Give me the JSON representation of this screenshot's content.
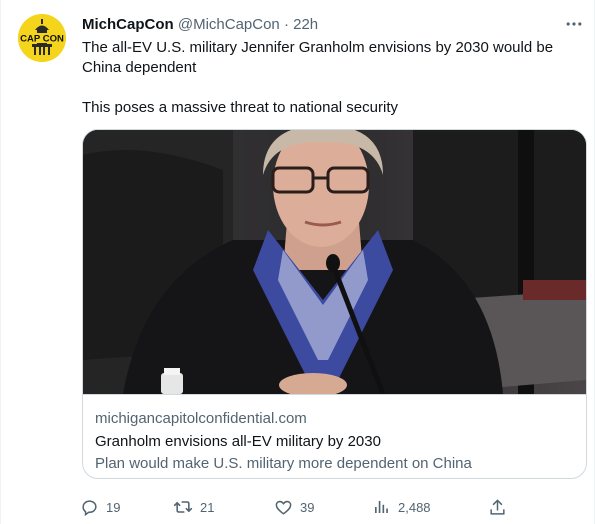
{
  "tweet": {
    "avatar_text": "CAPCON",
    "display_name": "MichCapCon",
    "handle": "@MichCapCon",
    "separator": "·",
    "time": "22h",
    "more_icon": "more-horizontal-icon",
    "paragraphs": [
      "The all-EV U.S. military Jennifer Granholm envisions by 2030 would be China dependent",
      "This poses a massive threat to national security"
    ]
  },
  "card": {
    "domain": "michigancapitolconfidential.com",
    "title": "Granholm envisions all-EV military by 2030",
    "description": "Plan would make U.S. military more dependent on China"
  },
  "actions": {
    "reply": {
      "icon": "reply-icon",
      "count": "19"
    },
    "retweet": {
      "icon": "retweet-icon",
      "count": "21"
    },
    "like": {
      "icon": "heart-icon",
      "count": "39"
    },
    "views": {
      "icon": "views-chart-icon",
      "count": "2,488"
    },
    "share": {
      "icon": "share-icon"
    }
  }
}
